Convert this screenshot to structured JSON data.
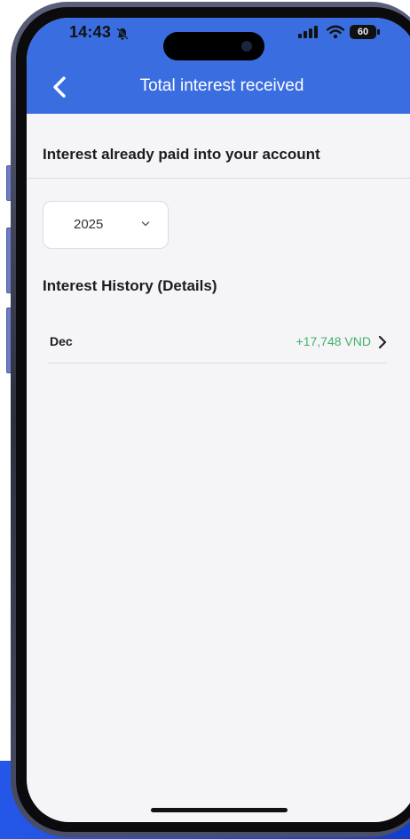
{
  "status_bar": {
    "time": "14:43",
    "battery": "60",
    "icons": [
      "bell-muted-icon",
      "signal-icon",
      "wifi-icon",
      "battery-icon"
    ]
  },
  "header": {
    "title": "Total interest received",
    "back_icon": "chevron-left-icon",
    "background_color": "#3a6ee0"
  },
  "summary": {
    "title": "Interest already paid into your account"
  },
  "year_filter": {
    "selected": "2025",
    "icon": "chevron-down-icon"
  },
  "history": {
    "title": "Interest History (Details)",
    "items": [
      {
        "month": "Dec",
        "amount": "+17,748 VND",
        "amount_color": "#44b06a",
        "icon": "chevron-right-icon"
      }
    ]
  }
}
